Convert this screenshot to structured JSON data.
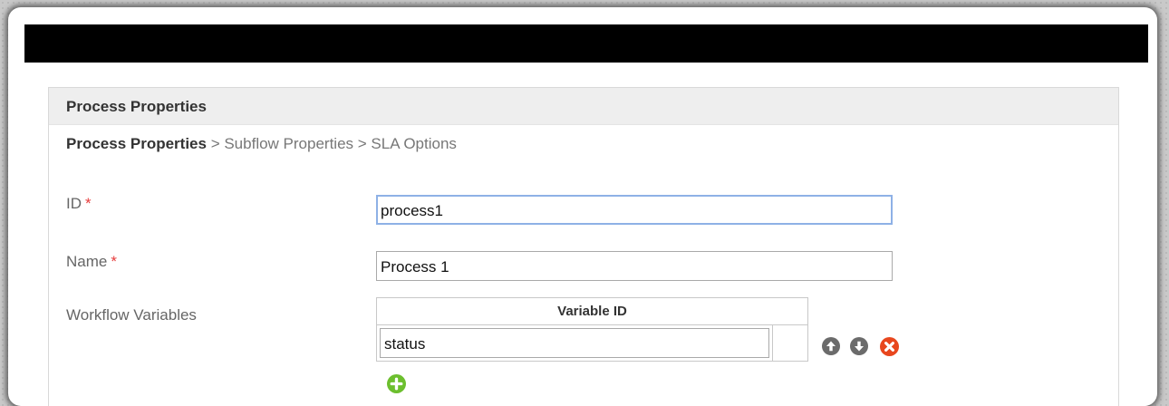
{
  "panel": {
    "title": "Process Properties"
  },
  "breadcrumb": {
    "current": "Process Properties",
    "separator": " > ",
    "items": [
      "Subflow Properties",
      "SLA Options"
    ]
  },
  "form": {
    "required_marker": "*",
    "id": {
      "label": "ID",
      "value": "process1"
    },
    "name": {
      "label": "Name",
      "value": "Process 1"
    },
    "workflow_variables": {
      "label": "Workflow Variables",
      "column_header": "Variable ID",
      "rows": [
        {
          "value": "status"
        }
      ]
    }
  },
  "icons": {
    "move_up": "arrow-up-circle-icon",
    "move_down": "arrow-down-circle-icon",
    "delete": "close-circle-icon",
    "add": "plus-circle-icon"
  },
  "colors": {
    "titlebar": "#000000",
    "header_bg": "#eeeeee",
    "required": "#e63c3c",
    "move_buttons": "#6b6b6b",
    "delete_button": "#e8471e",
    "add_button": "#6cbf2e",
    "focus_border": "#8eb1e6"
  }
}
